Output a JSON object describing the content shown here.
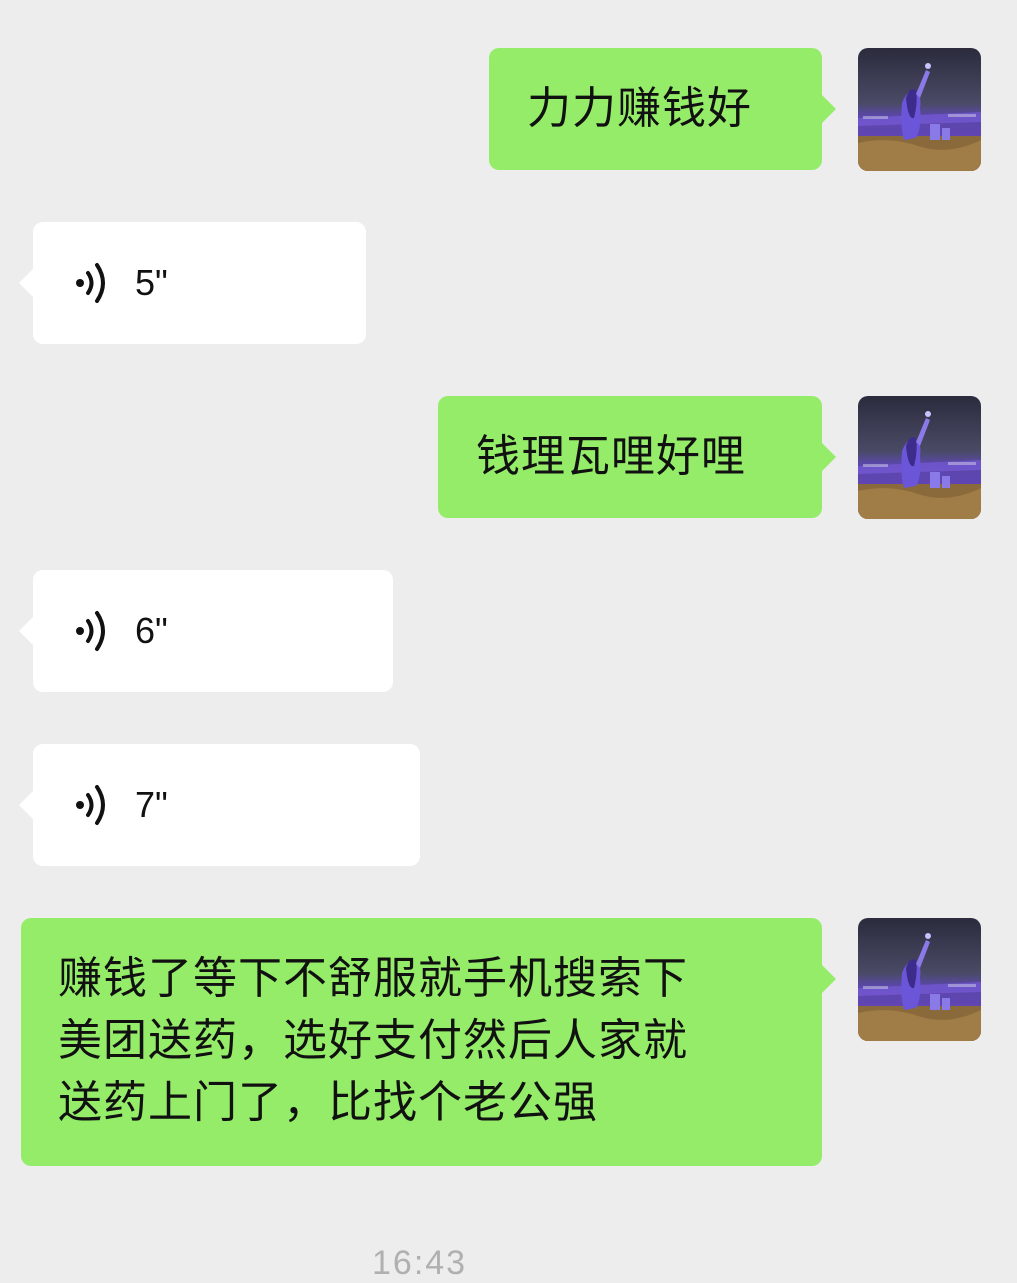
{
  "messages": [
    {
      "type": "sent",
      "text": "力力赚钱好"
    },
    {
      "type": "voice",
      "duration": "5\""
    },
    {
      "type": "sent",
      "text": "钱理瓦哩好哩"
    },
    {
      "type": "voice",
      "duration": "6\""
    },
    {
      "type": "voice",
      "duration": "7\""
    },
    {
      "type": "sent",
      "text": "赚钱了等下不舒服就手机搜索下\n美团送药，选好支付然后人家就\n送药上门了，比找个老公强"
    }
  ],
  "timestamp": "16:43",
  "colors": {
    "background": "#ededed",
    "sent_bubble": "#95ec69",
    "received_bubble": "#ffffff"
  },
  "icons": {
    "voice": "voice-wave-icon",
    "avatar": "user-avatar"
  }
}
